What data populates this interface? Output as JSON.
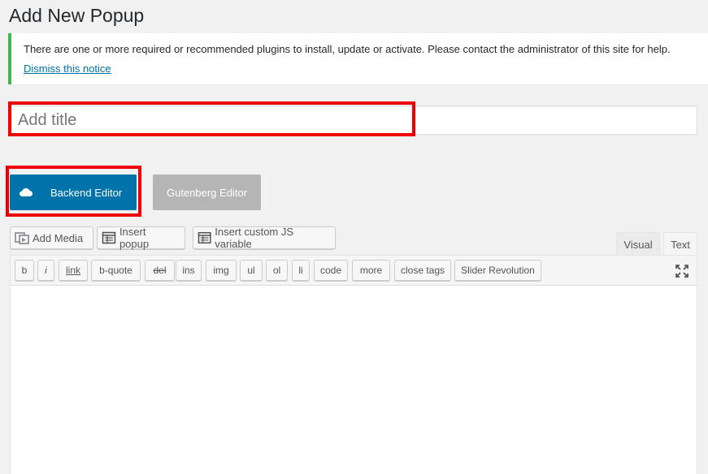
{
  "page": {
    "title": "Add New Popup"
  },
  "notice": {
    "text": "There are one or more required or recommended plugins to install, update or activate. Please contact the administrator of this site for help.",
    "dismiss_label": "Dismiss this notice",
    "accent_color": "#46b450"
  },
  "title_field": {
    "placeholder": "Add title",
    "value": ""
  },
  "editor_switch": {
    "backend_label": "Backend Editor",
    "backend_icon": "cloud-icon",
    "gutenberg_label": "Gutenberg Editor"
  },
  "media_buttons": [
    {
      "label": "Add Media",
      "icon": "media-icon"
    },
    {
      "label": "Insert popup",
      "icon": "table-icon"
    },
    {
      "label": "Insert custom JS variable",
      "icon": "table-icon"
    }
  ],
  "editor_tabs": {
    "visual": "Visual",
    "text": "Text",
    "active": "Text"
  },
  "quicktags": [
    "b",
    "i",
    "link",
    "b-quote",
    "del",
    "ins",
    "img",
    "ul",
    "ol",
    "li",
    "code",
    "more",
    "close tags",
    "Slider Revolution"
  ],
  "colors": {
    "primary": "#0073aa",
    "highlight": "#ee0000",
    "disabled": "#b5b5b5"
  }
}
